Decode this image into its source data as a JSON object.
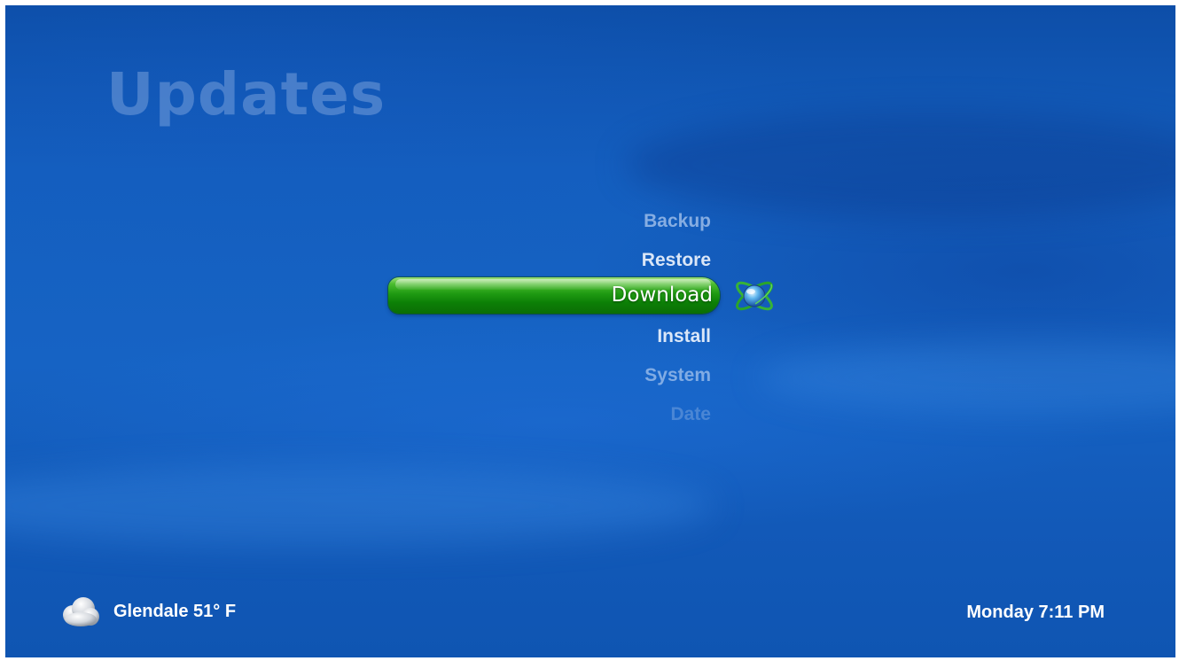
{
  "header": {
    "title": "Updates"
  },
  "menu": {
    "items": [
      {
        "label": "Backup"
      },
      {
        "label": "Restore"
      },
      {
        "label": "Download",
        "selected": true
      },
      {
        "label": "Install"
      },
      {
        "label": "System"
      },
      {
        "label": "Date"
      }
    ],
    "selected_icon": "atom-orbit-icon"
  },
  "footer": {
    "weather_icon": "cloud-icon",
    "weather": "Glendale 51° F",
    "clock": "Monday 7:11 PM"
  },
  "colors": {
    "background": "#1663c4",
    "selected_bar": "#1f9a12",
    "text": "#ffffff"
  }
}
